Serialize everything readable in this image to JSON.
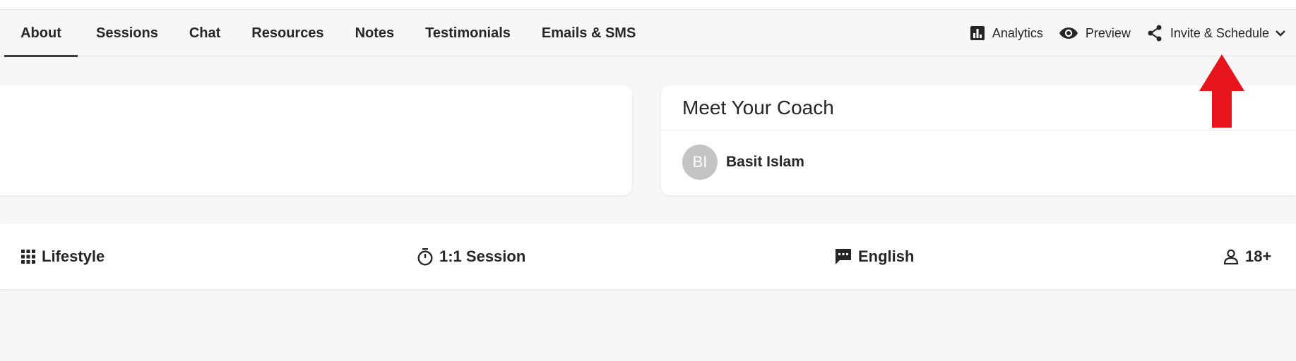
{
  "nav": {
    "tabs": [
      {
        "label": "About",
        "active": true
      },
      {
        "label": "Sessions",
        "active": false
      },
      {
        "label": "Chat",
        "active": false
      },
      {
        "label": "Resources",
        "active": false
      },
      {
        "label": "Notes",
        "active": false
      },
      {
        "label": "Testimonials",
        "active": false
      },
      {
        "label": "Emails & SMS",
        "active": false
      }
    ],
    "actions": {
      "analytics": {
        "label": "Analytics",
        "icon": "bar-chart-icon"
      },
      "preview": {
        "label": "Preview",
        "icon": "eye-icon"
      },
      "invite": {
        "label": "Invite & Schedule",
        "icon": "share-icon",
        "chevron": "chevron-down-icon"
      }
    }
  },
  "coach_card": {
    "title": "Meet Your Coach",
    "avatar_initials": "BI",
    "name": "Basit Islam"
  },
  "info": {
    "category": {
      "label": "Lifestyle",
      "icon": "grid-icon"
    },
    "session": {
      "label": "1:1 Session",
      "icon": "stopwatch-icon"
    },
    "language": {
      "label": "English",
      "icon": "chat-bubble-icon"
    },
    "age": {
      "label": "18+",
      "icon": "person-icon"
    }
  },
  "colors": {
    "accent_arrow": "#e8141c",
    "background": "#f7f7f7",
    "card": "#ffffff",
    "avatar": "#c4c4c4"
  }
}
